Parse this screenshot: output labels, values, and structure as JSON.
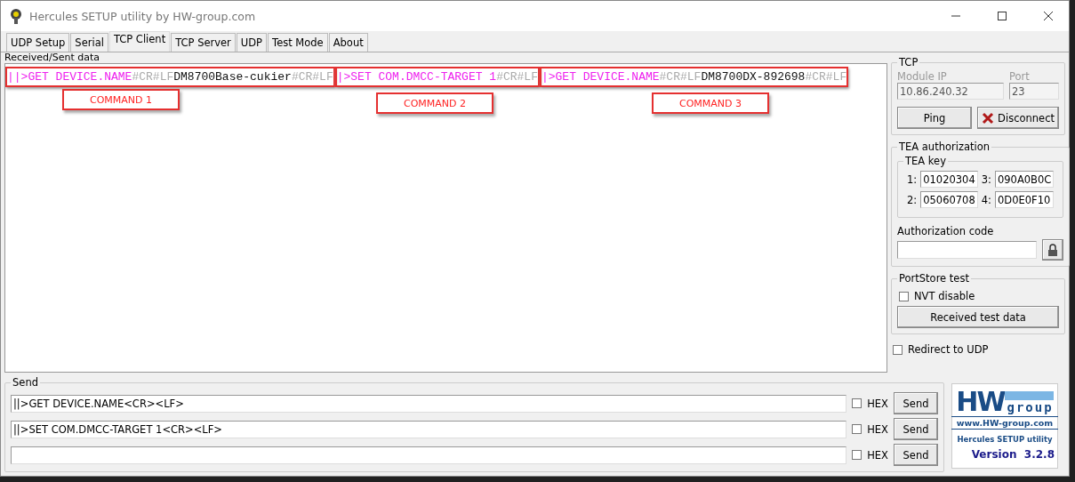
{
  "window": {
    "title": "Hercules SETUP utility by HW-group.com"
  },
  "tabs": [
    {
      "label": "UDP Setup",
      "selected": false
    },
    {
      "label": "Serial",
      "selected": false
    },
    {
      "label": "TCP Client",
      "selected": true
    },
    {
      "label": "TCP Server",
      "selected": false
    },
    {
      "label": "UDP",
      "selected": false
    },
    {
      "label": "Test Mode",
      "selected": false
    },
    {
      "label": "About",
      "selected": false
    }
  ],
  "received": {
    "label": "Received/Sent data",
    "groups": [
      {
        "segments": [
          {
            "kind": "sent",
            "text": "||>GET DEVICE.NAME"
          },
          {
            "kind": "control",
            "text": "#CR#LF"
          },
          {
            "kind": "reply",
            "text": "DM8700Base-cukier"
          },
          {
            "kind": "control",
            "text": "#CR#LF"
          }
        ],
        "annotation": "COMMAND 1"
      },
      {
        "segments": [
          {
            "kind": "sent",
            "text": "|>SET COM.DMCC-TARGET 1"
          },
          {
            "kind": "control",
            "text": "#CR#LF"
          }
        ],
        "annotation": "COMMAND 2"
      },
      {
        "segments": [
          {
            "kind": "sent",
            "text": "|>GET DEVICE.NAME"
          },
          {
            "kind": "control",
            "text": "#CR#LF"
          },
          {
            "kind": "reply",
            "text": "DM8700DX-892698"
          },
          {
            "kind": "control",
            "text": "#CR#LF"
          }
        ],
        "annotation": "COMMAND 3"
      }
    ]
  },
  "tcp": {
    "title": "TCP",
    "module_ip": {
      "label": "Module IP",
      "value": "10.86.240.32"
    },
    "port": {
      "label": "Port",
      "value": "23"
    },
    "ping": "Ping",
    "disconnect": "Disconnect"
  },
  "tea": {
    "title": "TEA authorization",
    "key_title": "TEA key",
    "keys": [
      {
        "label": "1:",
        "value": "01020304"
      },
      {
        "label": "3:",
        "value": "090A0B0C"
      },
      {
        "label": "2:",
        "value": "05060708"
      },
      {
        "label": "4:",
        "value": "0D0E0F10"
      }
    ],
    "auth_label": "Authorization code"
  },
  "portstore": {
    "title": "PortStore test",
    "nvt": {
      "label": "NVT disable",
      "checked": false
    },
    "button": "Received test data"
  },
  "redirect": {
    "label": "Redirect to UDP",
    "checked": false
  },
  "send": {
    "title": "Send",
    "rows": [
      {
        "value": "||>GET DEVICE.NAME<CR><LF>",
        "hex": {
          "label": "HEX",
          "checked": false
        },
        "button": "Send"
      },
      {
        "value": "||>SET COM.DMCC-TARGET 1<CR><LF>",
        "hex": {
          "label": "HEX",
          "checked": false
        },
        "button": "Send"
      },
      {
        "hex": {
          "label": "HEX",
          "checked": false
        },
        "button": "Send"
      }
    ]
  },
  "logo": {
    "brand_a": "HW",
    "brand_b": "group",
    "url": "www.HW-group.com",
    "product": "Hercules SETUP utility",
    "version": "Version  3.2.8"
  }
}
